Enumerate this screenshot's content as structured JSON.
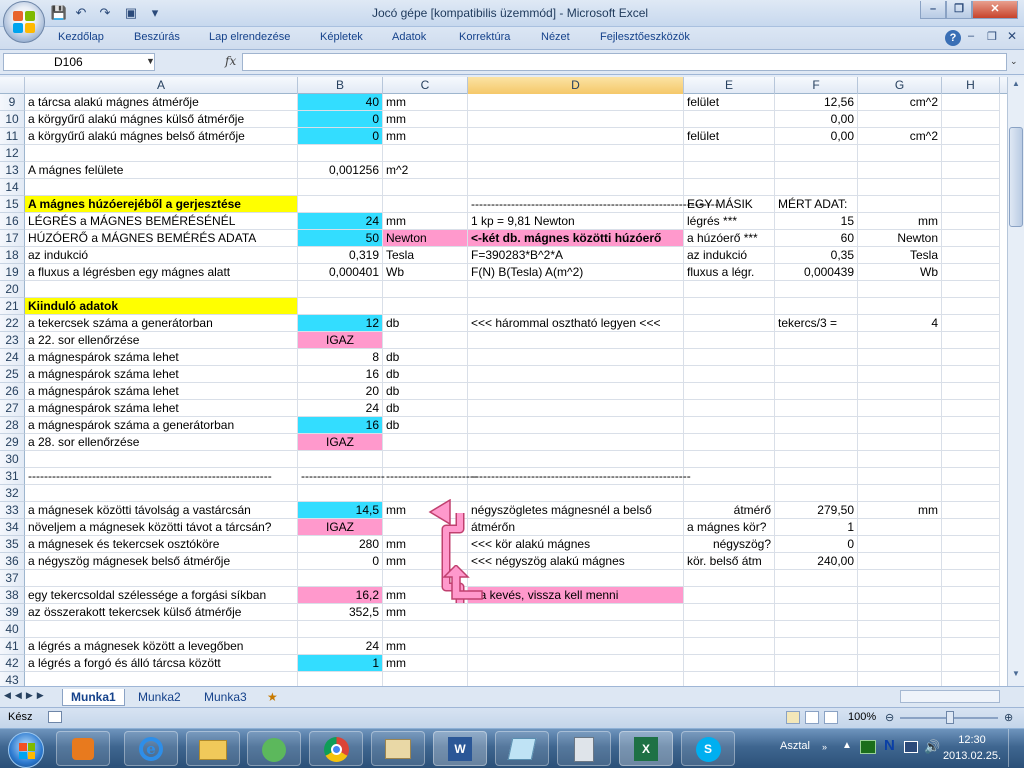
{
  "window": {
    "title": "Jocó gépe  [kompatibilis üzemmód] - Microsoft Excel",
    "qat_dropdown": "▾"
  },
  "ribbon": {
    "tabs": [
      "Kezdőlap",
      "Beszúrás",
      "Lap elrendezése",
      "Képletek",
      "Adatok",
      "Korrektúra",
      "Nézet",
      "Fejlesztőeszközök"
    ]
  },
  "formula_bar": {
    "name_box": "D106",
    "fx": "fx",
    "value": ""
  },
  "columns": [
    "A",
    "B",
    "C",
    "D",
    "E",
    "F",
    "G",
    "H"
  ],
  "rows": [
    {
      "n": "9",
      "cells": {
        "A": "a tárcsa alakú mágnes átmérője",
        "B": "40",
        "C": "mm",
        "E": "felület",
        "F": "12,56",
        "G": "cm^2"
      }
    },
    {
      "n": "10",
      "cells": {
        "A": "a körgyűrű alakú mágnes külső átmérője",
        "B": "0",
        "C": "mm",
        "F": "0,00"
      }
    },
    {
      "n": "11",
      "cells": {
        "A": "a körgyűrű alakú mágnes belső átmérője",
        "B": "0",
        "C": "mm",
        "E": "felület",
        "F": "0,00",
        "G": "cm^2"
      }
    },
    {
      "n": "12",
      "cells": {}
    },
    {
      "n": "13",
      "cells": {
        "A": "A mágnes felülete",
        "B": "0,001256",
        "C": "m^2"
      }
    },
    {
      "n": "14",
      "cells": {}
    },
    {
      "n": "15",
      "cells": {
        "A": " A mágnes  húzóerejéből a gerjesztése",
        "D": "--------------------------------------------------------------",
        "E": " EGY MÁSIK",
        "F": "MÉRT ADAT:"
      }
    },
    {
      "n": "16",
      "cells": {
        "A": "LÉGRÉS a MÁGNES BEMÉRÉSÉNÉL",
        "B": "24",
        "C": "mm",
        "D": "   1 kp = 9,81 Newton",
        "E": "légrés        ***",
        "F": "15",
        "G": "mm"
      }
    },
    {
      "n": "17",
      "cells": {
        "A": "HÚZÓERŐ a MÁGNES BEMÉRÉS ADATA",
        "B": "50",
        "C": "Newton",
        "D": "<-két db. mágnes közötti húzóerő",
        "E": "a húzóerő    ***",
        "F": "60",
        "G": "Newton"
      }
    },
    {
      "n": "18",
      "cells": {
        "A": "az indukció",
        "B": "0,319",
        "C": "Tesla",
        "D": "F=390283*B^2*A",
        "E": "az indukció",
        "F": "0,35",
        "G": "Tesla"
      }
    },
    {
      "n": "19",
      "cells": {
        "A": "a fluxus a légrésben egy mágnes alatt",
        "B": "0,000401",
        "C": "Wb",
        "D": "F(N)   B(Tesla)   A(m^2)",
        "E": "fluxus a légr.",
        "F": "0,000439",
        "G": "Wb"
      }
    },
    {
      "n": "20",
      "cells": {}
    },
    {
      "n": "21",
      "cells": {
        "A": " Kiinduló adatok"
      }
    },
    {
      "n": "22",
      "cells": {
        "A": "a tekercsek száma a generátorban",
        "B": "12",
        "C": "db",
        "D": "<<< hárommal osztható legyen <<<",
        "F": "tekercs/3    =",
        "G": "4"
      }
    },
    {
      "n": "23",
      "cells": {
        "A": "a 22. sor ellenőrzése",
        "B": "IGAZ"
      }
    },
    {
      "n": "24",
      "cells": {
        "A": "a mágnespárok száma lehet",
        "B": "8",
        "C": "db"
      }
    },
    {
      "n": "25",
      "cells": {
        "A": "a mágnespárok száma lehet",
        "B": "16",
        "C": "db"
      }
    },
    {
      "n": "26",
      "cells": {
        "A": "a mágnespárok száma lehet",
        "B": "20",
        "C": "db"
      }
    },
    {
      "n": "27",
      "cells": {
        "A": "a mágnespárok száma lehet",
        "B": "24",
        "C": "db"
      }
    },
    {
      "n": "28",
      "cells": {
        "A": "a mágnespárok száma a generátorban",
        "B": "16",
        "C": "db"
      }
    },
    {
      "n": "29",
      "cells": {
        "A": "a 28. sor ellenőrzése",
        "B": "IGAZ"
      }
    },
    {
      "n": "30",
      "cells": {}
    },
    {
      "n": "31",
      "cells": {
        "A": "-------------------------------------------------------------",
        "B": "---------------------",
        "C": "-----------------------",
        "D": "-------------------------------------------------------"
      }
    },
    {
      "n": "32",
      "cells": {}
    },
    {
      "n": "33",
      "cells": {
        "A": "a mágnesek közötti távolság a vastárcsán",
        "B": "14,5",
        "C": "mm",
        "D": "négyszögletes mágnesnél a belső",
        "E": "átmérő",
        "F": "279,50",
        "G": "mm"
      }
    },
    {
      "n": "34",
      "cells": {
        "A": "növeljem a mágnesek közötti távot a tárcsán?",
        "B": "IGAZ",
        "D": "átmérőn",
        "E": "a mágnes kör?",
        "F": "1"
      }
    },
    {
      "n": "35",
      "cells": {
        "A": "a mágnesek és tekercsek osztóköre",
        "B": "280",
        "C": "mm",
        "D": "<<< kör alakú mágnes",
        "E": "négyszög?",
        "F": "0"
      }
    },
    {
      "n": "36",
      "cells": {
        "A": "a négyszög mágnesek belső átmérője",
        "B": "0",
        "C": "mm",
        "D": "<<< négyszög alakú mágnes",
        "E": "kör. belső átm",
        "F": "240,00"
      }
    },
    {
      "n": "37",
      "cells": {}
    },
    {
      "n": "38",
      "cells": {
        "A": "egy tekercsoldal szélessége a forgási síkban",
        "B": "16,2",
        "C": "mm",
        "D": "Ha kevés, vissza kell menni"
      }
    },
    {
      "n": "39",
      "cells": {
        "A": "az összerakott tekercsek külső átmérője",
        "B": "352,5",
        "C": "mm"
      }
    },
    {
      "n": "40",
      "cells": {}
    },
    {
      "n": "41",
      "cells": {
        "A": "a légrés a mágnesek között a levegőben",
        "B": "24",
        "C": "mm"
      }
    },
    {
      "n": "42",
      "cells": {
        "A": "a légrés a forgó és álló tárcsa között",
        "B": "1",
        "C": "mm"
      }
    },
    {
      "n": "43",
      "cells": {}
    }
  ],
  "sheets": [
    "Munka1",
    "Munka2",
    "Munka3"
  ],
  "active_sheet": "Munka1",
  "status": {
    "ready": "Kész",
    "zoom": "100%"
  },
  "taskbar": {
    "desktop_label": "Asztal",
    "time": "12:30",
    "date": "2013.02.25."
  }
}
